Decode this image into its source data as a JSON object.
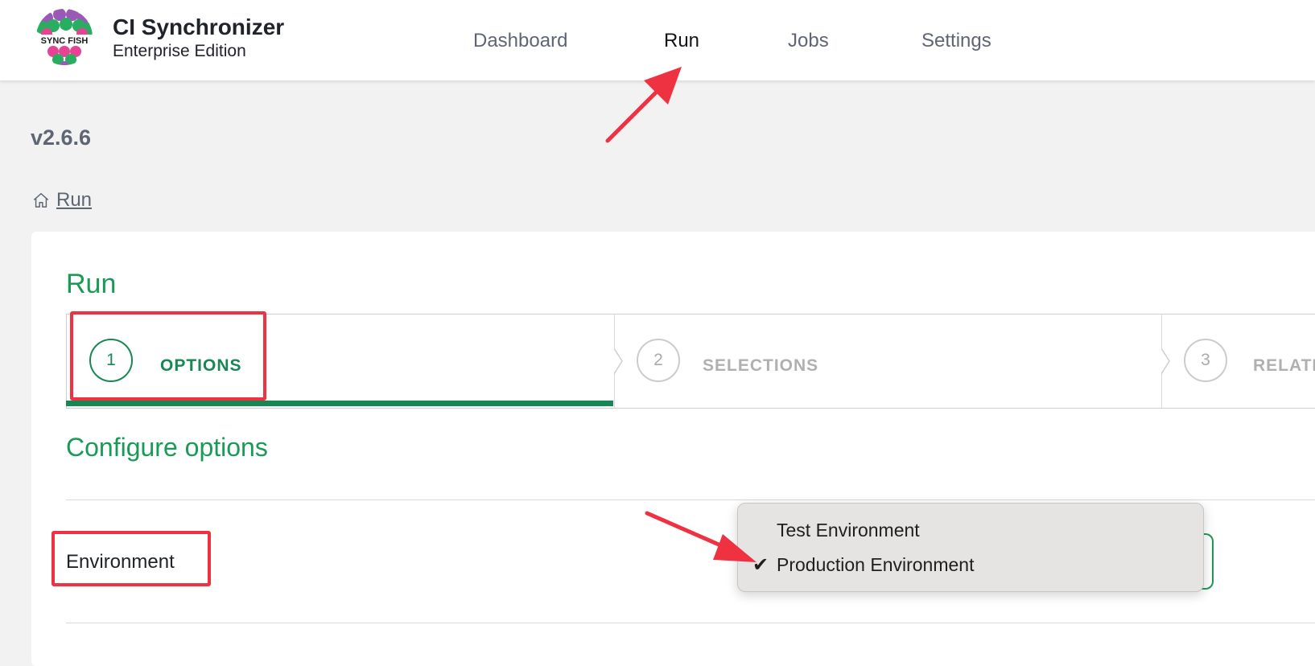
{
  "header": {
    "logo_text": "SYNC FISH",
    "title": "CI Synchronizer",
    "subtitle": "Enterprise Edition",
    "nav": [
      {
        "label": "Dashboard"
      },
      {
        "label": "Run",
        "active": true
      },
      {
        "label": "Jobs"
      },
      {
        "label": "Settings"
      }
    ]
  },
  "version": "v2.6.6",
  "breadcrumb": {
    "icon": "home-icon",
    "label": "Run"
  },
  "page": {
    "heading": "Run",
    "steps": [
      {
        "number": "1",
        "label": "OPTIONS",
        "state": "active"
      },
      {
        "number": "2",
        "label": "SELECTIONS",
        "state": "inactive"
      },
      {
        "number": "3",
        "label": "RELATI",
        "state": "inactive"
      }
    ],
    "section_title": "Configure options",
    "environment": {
      "label": "Environment",
      "options": [
        "Test Environment",
        "Production Environment"
      ],
      "selected": "Production Environment"
    }
  },
  "colors": {
    "accent_green": "#1a9a57",
    "progress_green": "#198754",
    "annotation_red": "#ee3241",
    "inactive_gray": "#b0b0b0"
  }
}
